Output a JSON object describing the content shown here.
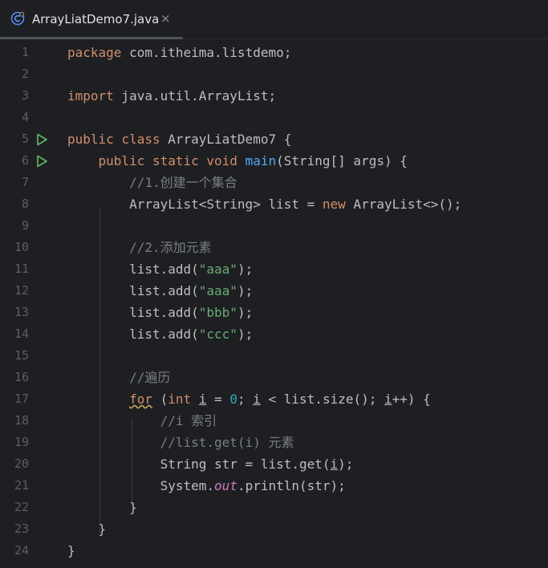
{
  "tab": {
    "filename": "ArrayLiatDemo7.java",
    "close": "×",
    "icon": "java-class-icon"
  },
  "editor": {
    "line_numbers": [
      "1",
      "2",
      "3",
      "4",
      "5",
      "6",
      "7",
      "8",
      "9",
      "10",
      "11",
      "12",
      "13",
      "14",
      "15",
      "16",
      "17",
      "18",
      "19",
      "20",
      "21",
      "22",
      "23",
      "24"
    ],
    "run_gutter_lines": [
      5,
      6
    ],
    "colors": {
      "keyword": "#cf8e6d",
      "string": "#6aab73",
      "comment": "#7a7e85",
      "method": "#56a8f5",
      "static_field": "#c77dbb",
      "number": "#2aacb8",
      "text": "#bcbec4"
    },
    "code": {
      "l1_kw": "package",
      "l1_rest": " com.itheima.listdemo;",
      "l3_kw": "import",
      "l3_rest": " java.util.ArrayList;",
      "l5_kw": "public class",
      "l5_rest": " ArrayLiatDemo7 {",
      "l6_kw": "public static void",
      "l6_fn": "main",
      "l6_rest": "(String[] args) {",
      "l7_cm": "//1.创建一个集合",
      "l8_a": "ArrayList<String> list = ",
      "l8_kw": "new",
      "l8_b": " ArrayList<>();",
      "l10_cm": "//2.添加元素",
      "add_prefix": "list.add(",
      "add_suffix": ");",
      "l11_str": "\"aaa\"",
      "l12_str": "\"aaa\"",
      "l13_str": "\"bbb\"",
      "l14_str": "\"ccc\"",
      "l16_cm": "//遍历",
      "l17_for": "for",
      "l17_a": " (",
      "l17_int": "int",
      "l17_i1": "i",
      "l17_eq": " = ",
      "l17_zero": "0",
      "l17_semi": "; ",
      "l17_i2": "i",
      "l17_mid": " < list.size(); ",
      "l17_i3": "i",
      "l17_end": "++) {",
      "l18_cm": "//i 索引",
      "l19_cm": "//list.get(i) 元素",
      "l20_a": "String str = list.get(",
      "l20_i": "i",
      "l20_b": ");",
      "l21_a": "System.",
      "l21_out": "out",
      "l21_b": ".println(str);",
      "close_brace": "}"
    }
  }
}
